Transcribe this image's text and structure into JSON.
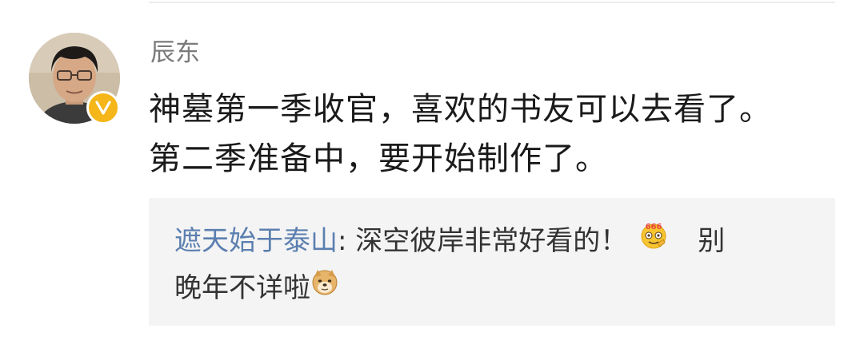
{
  "post": {
    "author": "辰东",
    "text_line1": "神墓第一季收官，喜欢的书友可以去看了。",
    "text_line2": "第二季准备中，要开始制作了。"
  },
  "comment": {
    "user": "遮天始于泰山",
    "separator": ": ",
    "text_part1": "深空彼岸非常好看的！",
    "emoji1": "666-face-emoji",
    "text_part2": "别",
    "text_part3": "晚年不详啦",
    "emoji2": "doge-emoji"
  },
  "colors": {
    "username": "#7a7a7a",
    "body_text": "#1a1a1a",
    "link_user": "#5b7fb0",
    "repost_bg": "#f4f4f4",
    "badge": "#f4b618"
  }
}
